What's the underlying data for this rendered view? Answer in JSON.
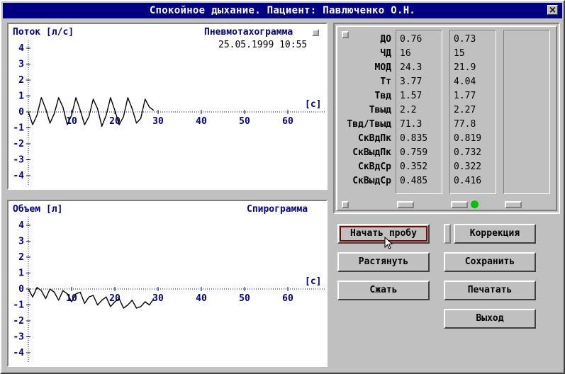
{
  "window": {
    "title": "Спокойное дыхание. Пациент: Павлюченко О.Н.",
    "close_glyph": "×"
  },
  "flow_graph": {
    "ylabel": "Поток [л/с]",
    "title": "Пневмотахограмма",
    "datetime": "25.05.1999 10:55",
    "xunit": "[с]",
    "yticks": [
      "4",
      "3",
      "2",
      "1",
      "0",
      "-1",
      "-2",
      "-3",
      "-4"
    ],
    "xticks": [
      "10",
      "20",
      "30",
      "40",
      "50",
      "60"
    ]
  },
  "volume_graph": {
    "ylabel": "Объем [л]",
    "title": "Спирограмма",
    "xunit": "[с]",
    "yticks": [
      "4",
      "3",
      "2",
      "1",
      "0",
      "-1",
      "-2",
      "-3",
      "-4"
    ],
    "xticks": [
      "10",
      "20",
      "30",
      "40",
      "50",
      "60"
    ]
  },
  "chart_data": [
    {
      "type": "line",
      "title": "Пневмотахограмма",
      "ylabel": "Поток [л/с]",
      "xlabel": "[с]",
      "xlim": [
        -1,
        68
      ],
      "ylim": [
        -4.5,
        4.5
      ],
      "xticks": [
        10,
        20,
        30,
        40,
        50,
        60
      ],
      "yticks": [
        -4,
        -3,
        -2,
        -1,
        0,
        1,
        2,
        3,
        4
      ],
      "series": [
        {
          "x": [
            0,
            1,
            2,
            3,
            4,
            5,
            6,
            7,
            8,
            9,
            10,
            11,
            12,
            13,
            14,
            15,
            16,
            17,
            18,
            19,
            20,
            21,
            22,
            23,
            24,
            25,
            26,
            27,
            28,
            29
          ],
          "values": [
            0,
            -0.8,
            -0.2,
            0.9,
            0.2,
            -0.7,
            -0.1,
            0.9,
            0.3,
            -0.8,
            -0.2,
            0.9,
            0.1,
            -0.8,
            -0.3,
            0.8,
            0.2,
            -0.9,
            -0.2,
            0.9,
            0.1,
            -0.8,
            -0.3,
            0.9,
            0.2,
            -0.7,
            -0.4,
            0.8,
            0.3,
            0.1
          ]
        }
      ]
    },
    {
      "type": "line",
      "title": "Спирограмма",
      "ylabel": "Объем [л]",
      "xlabel": "[с]",
      "xlim": [
        -1,
        68
      ],
      "ylim": [
        -4.5,
        4.5
      ],
      "xticks": [
        10,
        20,
        30,
        40,
        50,
        60
      ],
      "yticks": [
        -4,
        -3,
        -2,
        -1,
        0,
        1,
        2,
        3,
        4
      ],
      "series": [
        {
          "x": [
            0,
            1,
            2,
            3,
            4,
            5,
            6,
            7,
            8,
            9,
            10,
            11,
            12,
            13,
            14,
            15,
            16,
            17,
            18,
            19,
            20,
            21,
            22,
            23,
            24,
            25,
            26,
            27,
            28,
            29
          ],
          "values": [
            0,
            -0.5,
            0.1,
            -0.1,
            -0.6,
            0,
            -0.2,
            -0.7,
            -0.1,
            -0.3,
            -0.8,
            -0.3,
            -0.2,
            -0.9,
            -0.5,
            -0.4,
            -1.0,
            -0.7,
            -0.5,
            -1.1,
            -0.8,
            -0.6,
            -1.2,
            -1.0,
            -0.7,
            -1.2,
            -1.1,
            -0.8,
            -1.0,
            -0.6
          ]
        }
      ]
    }
  ],
  "params": {
    "rows": [
      {
        "name": "ДО",
        "v1": "0.76",
        "v2": "0.73"
      },
      {
        "name": "ЧД",
        "v1": "16",
        "v2": "15"
      },
      {
        "name": "МОД",
        "v1": "24.3",
        "v2": "21.9"
      },
      {
        "name": "Тт",
        "v1": "3.77",
        "v2": "4.04"
      },
      {
        "name": "Твд",
        "v1": "1.57",
        "v2": "1.77"
      },
      {
        "name": "Твыд",
        "v1": "2.2",
        "v2": "2.27"
      },
      {
        "name": "Твд/Твыд",
        "v1": "71.3",
        "v2": "77.8"
      },
      {
        "name": "СкВдПк",
        "v1": "0.835",
        "v2": "0.819"
      },
      {
        "name": "СкВыдПк",
        "v1": "0.759",
        "v2": "0.732"
      },
      {
        "name": "СкВдСр",
        "v1": "0.352",
        "v2": "0.322"
      },
      {
        "name": "СкВыдСр",
        "v1": "0.485",
        "v2": "0.416"
      }
    ]
  },
  "buttons": {
    "start": "Начать пробу",
    "correction": "Коррекция",
    "stretch": "Растянуть",
    "save": "Сохранить",
    "compress": "Сжать",
    "print": "Печатать",
    "exit": "Выход"
  },
  "colors": {
    "titlebar": "#000080",
    "axis_text": "#000080",
    "face": "#c0c0c0",
    "indicator": "#00c000",
    "default_outline": "#800000"
  }
}
